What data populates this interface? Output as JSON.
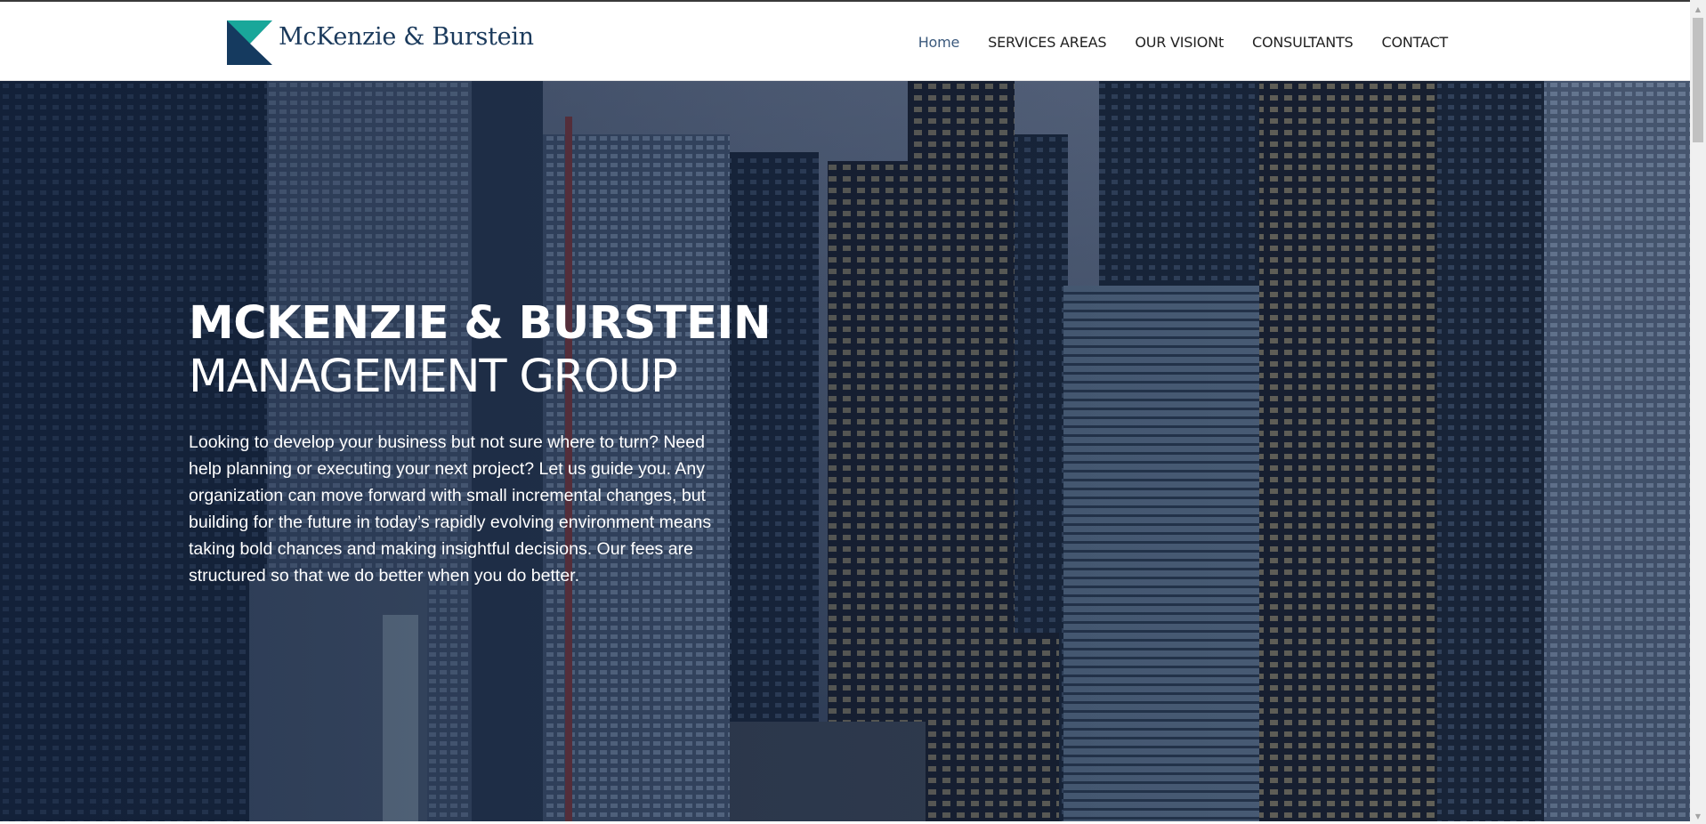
{
  "brand": {
    "name": "McKenzie & Burstein",
    "logo_icon": "logo-mark-icon",
    "colors": {
      "teal": "#19a79a",
      "navy": "#153a5f"
    }
  },
  "nav": {
    "items": [
      {
        "label": "Home",
        "active": true
      },
      {
        "label": "SERVICES AREAS",
        "active": false
      },
      {
        "label": "OUR VISIONt",
        "active": false
      },
      {
        "label": "CONSULTANTS",
        "active": false
      },
      {
        "label": "CONTACT",
        "active": false
      }
    ]
  },
  "hero": {
    "title": "MCKENZIE & BURSTEIN",
    "subtitle": "MANAGEMENT GROUP",
    "text": "Looking to develop your business but not sure where to turn? Need help planning or executing your next project? Let us guide you. Any organization can move forward with small incremental changes, but building for the future in today’s rapidly evolving environment means taking bold chances and making insightful decisions. Our fees are structured so that we do better when you do better.",
    "background": "city-skyline-photo",
    "overlay_color": "#0e1e3a"
  },
  "scrollbar": {
    "up_icon": "scroll-up-icon",
    "down_icon": "scroll-down-icon"
  }
}
